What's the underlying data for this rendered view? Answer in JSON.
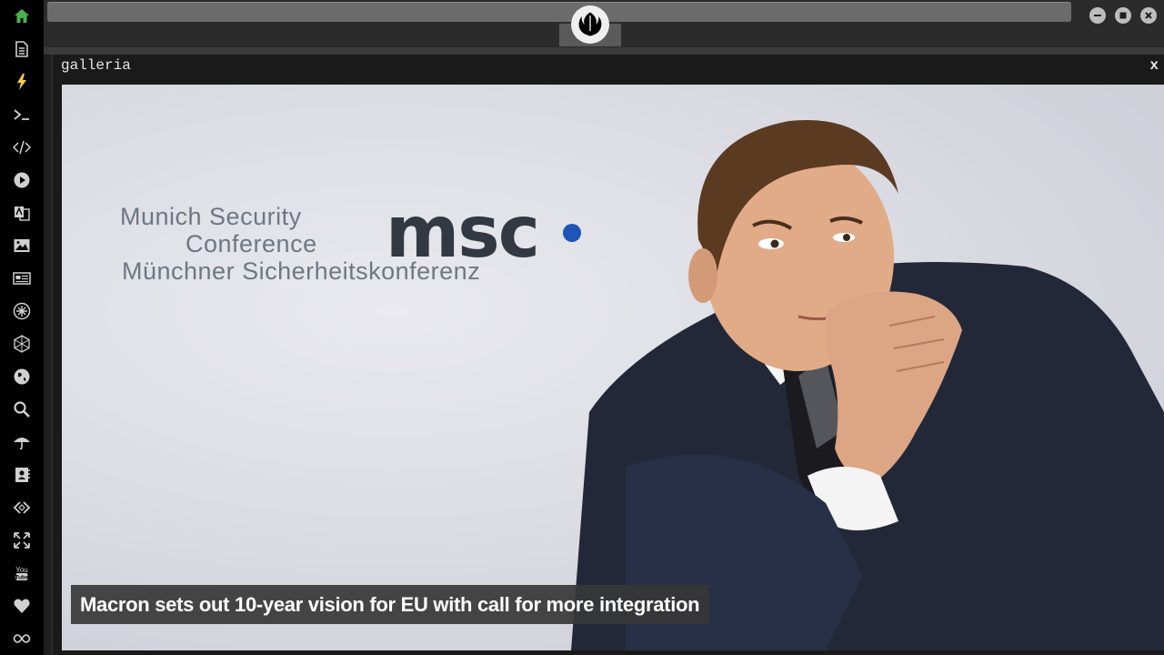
{
  "sidebar": {
    "items": [
      {
        "icon": "home-icon",
        "color": "#4caf50"
      },
      {
        "icon": "document-icon",
        "color": "#d0d0d0"
      },
      {
        "icon": "lightning-icon",
        "color": "#f2c94c"
      },
      {
        "icon": "terminal-icon",
        "color": "#d0d0d0"
      },
      {
        "icon": "code-icon",
        "color": "#d0d0d0"
      },
      {
        "icon": "play-icon",
        "color": "#d0d0d0"
      },
      {
        "icon": "translate-icon",
        "color": "#d0d0d0"
      },
      {
        "icon": "image-icon",
        "color": "#d0d0d0"
      },
      {
        "icon": "news-icon",
        "color": "#d0d0d0"
      },
      {
        "icon": "rebel-icon",
        "color": "#d0d0d0"
      },
      {
        "icon": "hexagon-icon",
        "color": "#d0d0d0"
      },
      {
        "icon": "globe-icon",
        "color": "#d0d0d0"
      },
      {
        "icon": "search-icon",
        "color": "#d0d0d0"
      },
      {
        "icon": "umbrella-icon",
        "color": "#d0d0d0"
      },
      {
        "icon": "contacts-icon",
        "color": "#d0d0d0"
      },
      {
        "icon": "share-code-icon",
        "color": "#d0d0d0"
      },
      {
        "icon": "expand-icon",
        "color": "#d0d0d0"
      },
      {
        "icon": "youtube-icon",
        "color": "#d0d0d0",
        "label": "You Tube"
      },
      {
        "icon": "heart-icon",
        "color": "#d0d0d0"
      },
      {
        "icon": "infinity-icon",
        "color": "#d0d0d0"
      }
    ]
  },
  "topbar": {
    "logo_icon": "rebel-alliance-icon",
    "window_controls": [
      "minimize-icon",
      "maximize-icon",
      "close-icon"
    ]
  },
  "gallery": {
    "title": "galleria",
    "close_label": "x",
    "image": {
      "logo_lines": [
        "Munich Security",
        "Conference",
        "Münchner Sicherheitskonferenz"
      ],
      "logo_word": "msc",
      "accent_color": "#1f55b5"
    },
    "caption": "Macron sets out 10-year vision for EU with call for more integration"
  }
}
